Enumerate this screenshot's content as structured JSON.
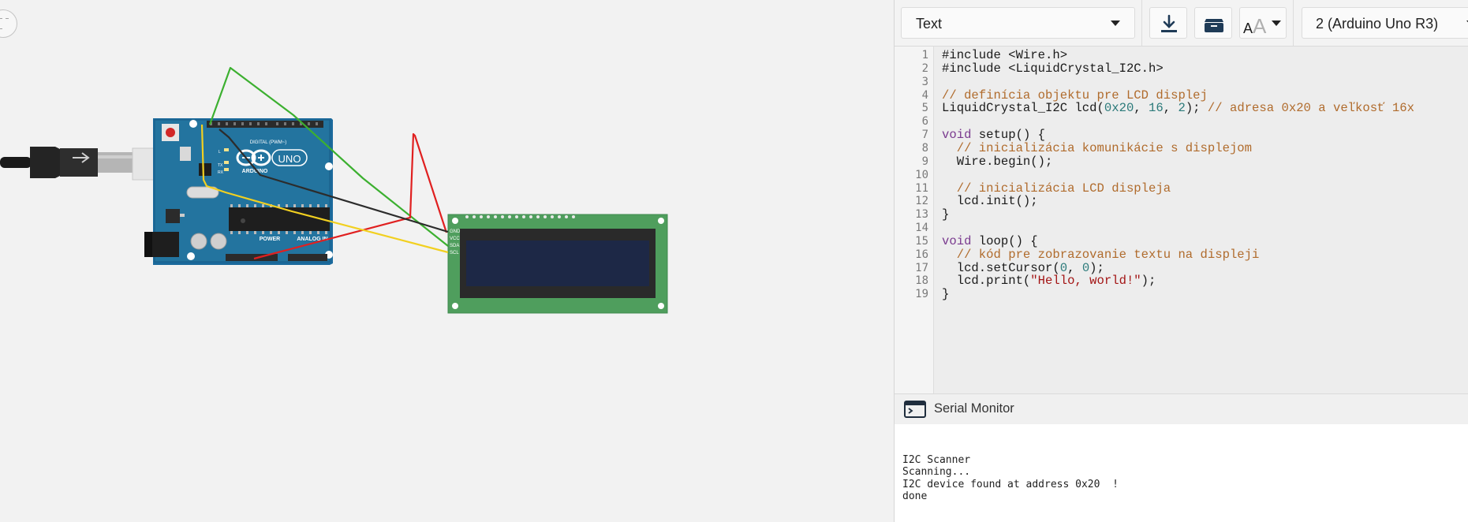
{
  "toolbar": {
    "mode_select": {
      "value": "Text",
      "icon": "chevron-down-icon"
    },
    "download_icon": "download-icon",
    "library_icon": "library-icon",
    "font_size_icon": "font-size-icon",
    "board_select": {
      "value": "2 (Arduino Uno R3)",
      "icon": "chevron-down-icon"
    }
  },
  "editor": {
    "line_numbers": [
      "1",
      "2",
      "3",
      "4",
      "5",
      "6",
      "7",
      "8",
      "9",
      "10",
      "11",
      "12",
      "13",
      "14",
      "15",
      "16",
      "17",
      "18",
      "19"
    ],
    "lines": [
      [
        {
          "t": "#include <Wire.h>",
          "c": "plain"
        }
      ],
      [
        {
          "t": "#include <LiquidCrystal_I2C.h>",
          "c": "plain"
        }
      ],
      [],
      [
        {
          "t": "// definícia objektu pre LCD displej",
          "c": "cm"
        }
      ],
      [
        {
          "t": "LiquidCrystal_I2C lcd(",
          "c": "plain"
        },
        {
          "t": "0x20",
          "c": "num"
        },
        {
          "t": ", ",
          "c": "plain"
        },
        {
          "t": "16",
          "c": "num"
        },
        {
          "t": ", ",
          "c": "plain"
        },
        {
          "t": "2",
          "c": "num"
        },
        {
          "t": "); ",
          "c": "plain"
        },
        {
          "t": "// adresa 0x20 a veľkosť 16x",
          "c": "cm"
        }
      ],
      [],
      [
        {
          "t": "void",
          "c": "kw"
        },
        {
          "t": " setup() {",
          "c": "plain"
        }
      ],
      [
        {
          "t": "  // inicializácia komunikácie s displejom",
          "c": "cm"
        }
      ],
      [
        {
          "t": "  Wire.begin();",
          "c": "plain"
        }
      ],
      [],
      [
        {
          "t": "  // inicializácia LCD displeja",
          "c": "cm"
        }
      ],
      [
        {
          "t": "  lcd.init();",
          "c": "plain"
        }
      ],
      [
        {
          "t": "}",
          "c": "plain"
        }
      ],
      [],
      [
        {
          "t": "void",
          "c": "kw"
        },
        {
          "t": " loop() {",
          "c": "plain"
        }
      ],
      [
        {
          "t": "  // kód pre zobrazovanie textu na displeji",
          "c": "cm"
        }
      ],
      [
        {
          "t": "  lcd.setCursor(",
          "c": "plain"
        },
        {
          "t": "0",
          "c": "num"
        },
        {
          "t": ", ",
          "c": "plain"
        },
        {
          "t": "0",
          "c": "num"
        },
        {
          "t": ");",
          "c": "plain"
        }
      ],
      [
        {
          "t": "  lcd.print(",
          "c": "plain"
        },
        {
          "t": "\"Hello, world!\"",
          "c": "str"
        },
        {
          "t": ");",
          "c": "plain"
        }
      ],
      [
        {
          "t": "}",
          "c": "plain"
        }
      ]
    ]
  },
  "serial_monitor": {
    "title": "Serial Monitor",
    "icon": "terminal-window-icon",
    "output": [
      "I2C Scanner",
      "Scanning...",
      "I2C device found at address 0x20  !",
      "done"
    ]
  },
  "circuit": {
    "arduino": {
      "brand": "ARDUINO",
      "model": "UNO",
      "digital_label": "DIGITAL (PWM~)",
      "power_label": "POWER",
      "analog_label": "ANALOG IN",
      "on_label": "ON",
      "tx_label": "TX",
      "rx_label": "RX",
      "l_label": "L"
    },
    "lcd": {
      "pins": [
        "GND",
        "VCC",
        "SDA",
        "SCL"
      ]
    },
    "wire_colors": {
      "gnd": "#2c2c2c",
      "vcc": "#e02020",
      "sda": "#3cb030",
      "scl": "#f2d020"
    }
  }
}
